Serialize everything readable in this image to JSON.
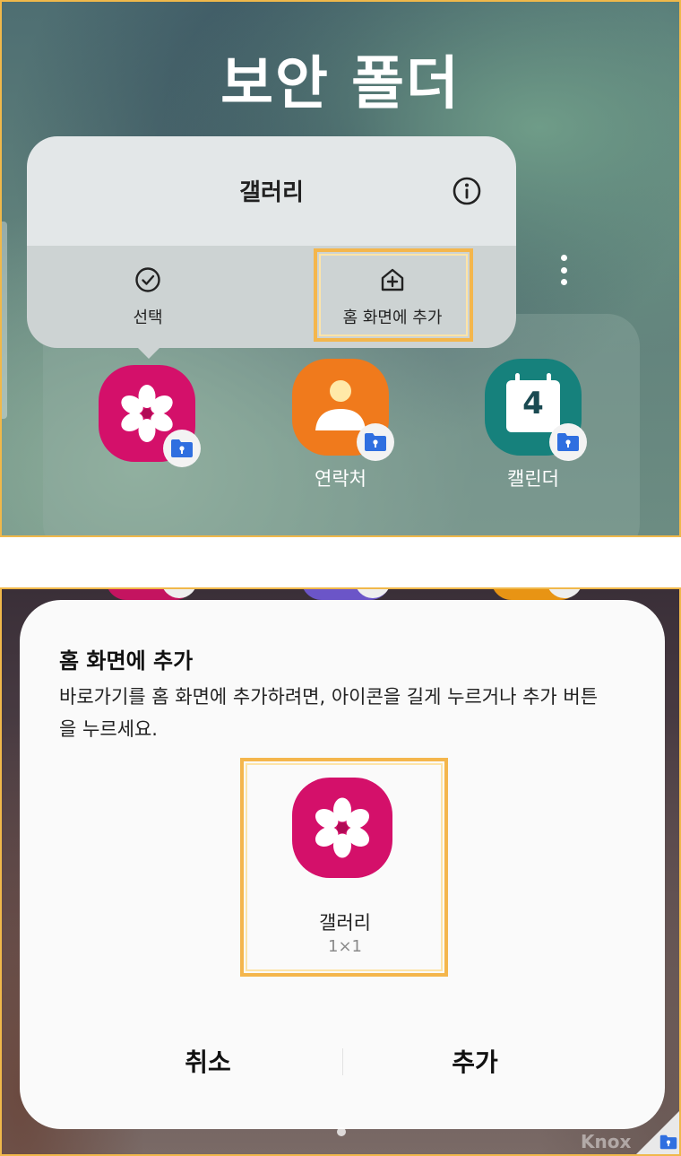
{
  "top_screen": {
    "folder_title": "보안 폴더",
    "popup": {
      "title": "갤러리",
      "info_icon": "info-circle-icon",
      "actions": [
        {
          "label": "선택",
          "icon": "check-circle-icon"
        },
        {
          "label": "홈 화면에 추가",
          "icon": "home-add-icon"
        }
      ]
    },
    "apps": [
      {
        "name": "갤러리",
        "label": "",
        "icon": "gallery-flower-icon",
        "color": "#d4106a"
      },
      {
        "name": "연락처",
        "label": "연락처",
        "icon": "contacts-person-icon",
        "color": "#f07a1c"
      },
      {
        "name": "캘린더",
        "label": "캘린더",
        "icon": "calendar-icon",
        "color": "#16817c",
        "calendar_day": "4"
      }
    ],
    "badge_icon": "secure-folder-icon"
  },
  "bottom_screen": {
    "sheet": {
      "title": "홈 화면에 추가",
      "description": "바로가기를 홈 화면에 추가하려면, 아이콘을 길게 누르거나 추가 버튼을 누르세요.",
      "preview": {
        "label": "갤러리",
        "size": "1×1",
        "icon": "gallery-flower-icon"
      },
      "cancel_label": "취소",
      "add_label": "추가"
    },
    "watermark": "Knox"
  },
  "colors": {
    "highlight": "#f4b64c",
    "gallery": "#d4106a",
    "contacts": "#f07a1c",
    "calendar": "#16817c",
    "secure_badge": "#2f6fe0"
  }
}
